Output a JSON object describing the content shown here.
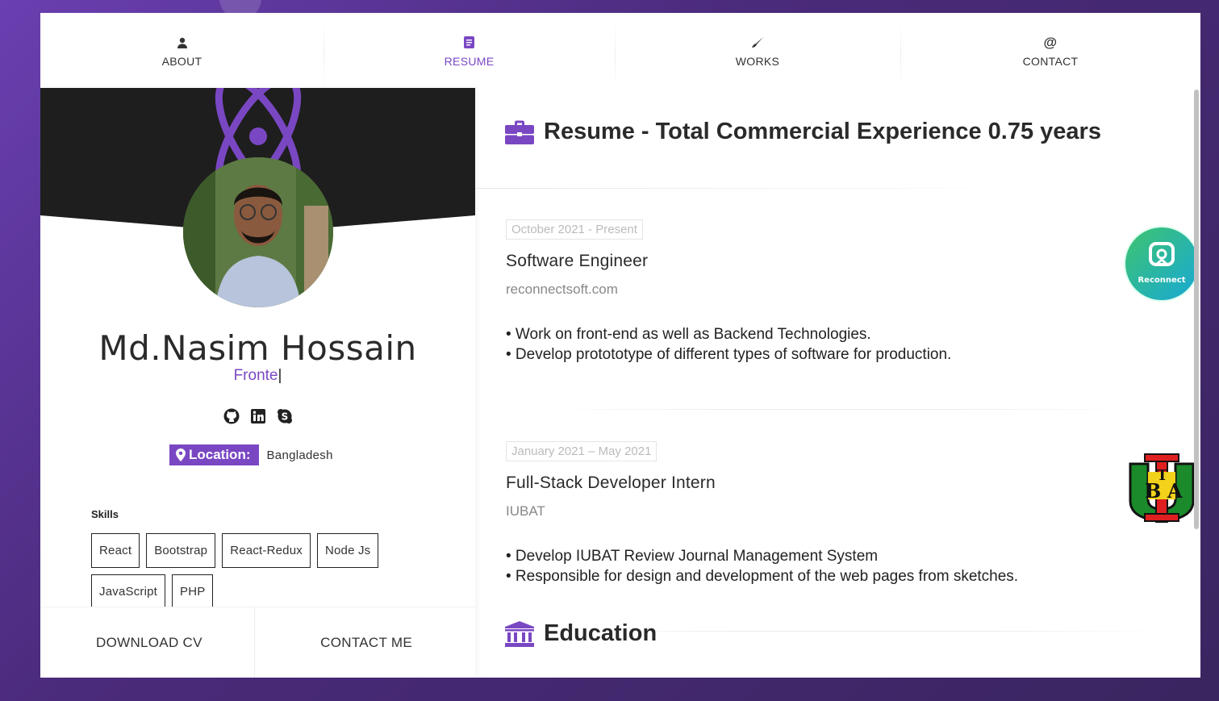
{
  "nav": {
    "items": [
      {
        "label": "ABOUT",
        "icon": "user-icon",
        "active": false
      },
      {
        "label": "RESUME",
        "icon": "document-icon",
        "active": true
      },
      {
        "label": "WORKS",
        "icon": "brush-icon",
        "active": false
      },
      {
        "label": "CONTACT",
        "icon": "at-icon",
        "active": false
      }
    ]
  },
  "profile": {
    "name": "Md.Nasim Hossain",
    "typed_role": "Fronte",
    "socials": [
      "github-icon",
      "linkedin-icon",
      "skype-icon"
    ],
    "location_label": "Location:",
    "location_value": "Bangladesh",
    "skills_label": "Skills",
    "skills": [
      "React",
      "Bootstrap",
      "React-Redux",
      "Node Js",
      "JavaScript",
      "PHP"
    ],
    "download_cv": "DOWNLOAD CV",
    "contact_me": "CONTACT ME"
  },
  "resume": {
    "title": "Resume - Total Commercial Experience 0.75 years",
    "jobs": [
      {
        "date": "October 2021 - Present",
        "title": "Software Engineer",
        "company": "reconnectsoft.com",
        "bullets": [
          "• Work on front-end as well as Backend Technologies.",
          "• Develop protototype of different types of software for production."
        ],
        "logo": "reconnect-logo",
        "logo_text": "Reconnect"
      },
      {
        "date": "January 2021 – May 2021",
        "title": "Full-Stack Developer Intern",
        "company": "IUBAT",
        "bullets": [
          "• Develop IUBAT Review Journal Management System",
          "• Responsible for design and development of the web pages from sketches."
        ],
        "logo": "iubat-logo",
        "logo_letters": [
          "B",
          "T",
          "A"
        ]
      }
    ],
    "education_title": "Education"
  },
  "colors": {
    "accent": "#7a47c3",
    "background_gradient": "#6a3fb1",
    "card_dark": "#1e1e1e"
  }
}
